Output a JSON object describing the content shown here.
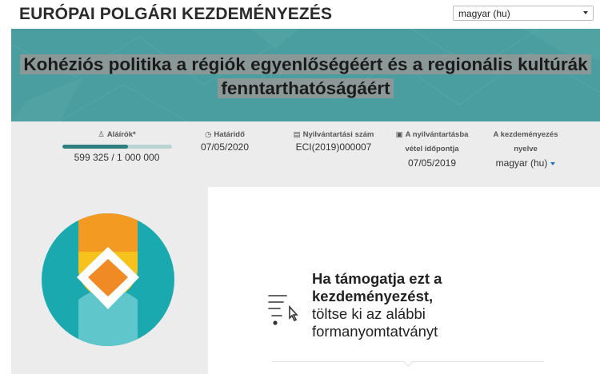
{
  "header": {
    "site_title": "EURÓPAI POLGÁRI KEZDEMÉNYEZÉS",
    "language_select_value": "magyar (hu)"
  },
  "banner": {
    "title": "Kohéziós politika a régiók egyenlőségéért és a regionális kultúrák fenntarthatóságáért"
  },
  "stats": {
    "signatories": {
      "label": "Aláírók*",
      "value": "599 325 / 1 000 000",
      "progress_fraction": 0.599
    },
    "deadline": {
      "label": "Határidő",
      "value": "07/05/2020"
    },
    "registration_number": {
      "label": "Nyilvántartási szám",
      "value": "ECI(2019)000007"
    },
    "registration_date": {
      "label_line1": "A nyilvántartásba",
      "label_line2": "vétel időpontja",
      "value": "07/05/2019"
    },
    "initiative_language": {
      "label_line1": "A kezdeményezés",
      "label_line2": "nyelve",
      "value": "magyar (hu)"
    }
  },
  "cta": {
    "strong_line1": "Ha támogatja ezt a",
    "strong_line2": "kezdeményezést,",
    "normal_line1": "töltse ki az alábbi",
    "normal_line2": "formanyomtatványt"
  },
  "colors": {
    "banner_teal": "#4a9e9f",
    "progress_fill": "#2f7f80",
    "logo_teal": "#1aa9ae",
    "logo_orange": "#f08a24",
    "logo_yellow": "#f7c21c",
    "logo_light_teal": "#5fc6cb"
  },
  "icons": {
    "language_caret": "chevron-down-icon",
    "signatories": "person-icon",
    "deadline": "alarm-clock-icon",
    "registration_number": "document-icon",
    "registration_date": "calendar-icon",
    "form": "form-pointer-icon"
  }
}
